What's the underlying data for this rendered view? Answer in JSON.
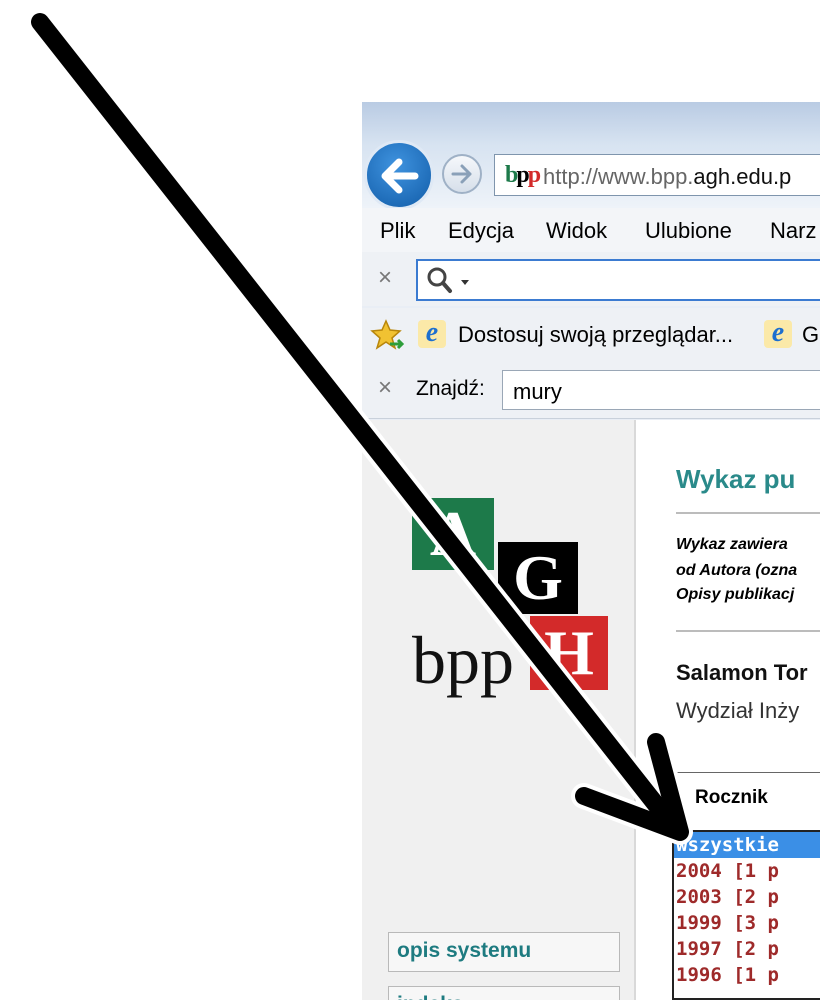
{
  "browser": {
    "address_url_prefix": "http://www.bpp.",
    "address_url_host": "agh.edu.p",
    "favicon_text": "bpp",
    "menu": [
      "Plik",
      "Edycja",
      "Widok",
      "Ulubione",
      "Narz"
    ],
    "favorites": [
      {
        "label": "Dostosuj swoją przeglądar..."
      },
      {
        "label": "G"
      }
    ],
    "find": {
      "label": "Znajdź:",
      "value": "mury"
    },
    "close_glyph": "×"
  },
  "sidebar": {
    "logo": {
      "a": "A",
      "g": "G",
      "h": "H",
      "bpp": "bpp"
    },
    "links": [
      "opis systemu",
      "indeks"
    ]
  },
  "main": {
    "heading": "Wykaz pu",
    "desc_lines": [
      "Wykaz zawiera",
      "od Autora (ozna",
      "Opisy publikacj"
    ],
    "author": "Salamon Tor",
    "department": "Wydział Inży",
    "filter_label": "Rocznik",
    "year_options": [
      "wszystkie",
      "2004 [1 p",
      "2003 [2 p",
      "1999 [3 p",
      "1997 [2 p",
      "1996 [1 p"
    ],
    "selected_index": 0
  },
  "colors": {
    "logo_a": "#1d7a4a",
    "logo_g": "#000000",
    "logo_h": "#d32a2a",
    "link_teal": "#1e7b80",
    "year_text": "#9e2a2a",
    "selection": "#3b8fe6"
  },
  "icons": [
    "back-arrow-icon",
    "forward-arrow-icon",
    "bpp-favicon-icon",
    "search-icon",
    "dropdown-caret-icon",
    "favorites-star-icon",
    "ie-page-icon",
    "close-icon",
    "annotation-arrow"
  ]
}
